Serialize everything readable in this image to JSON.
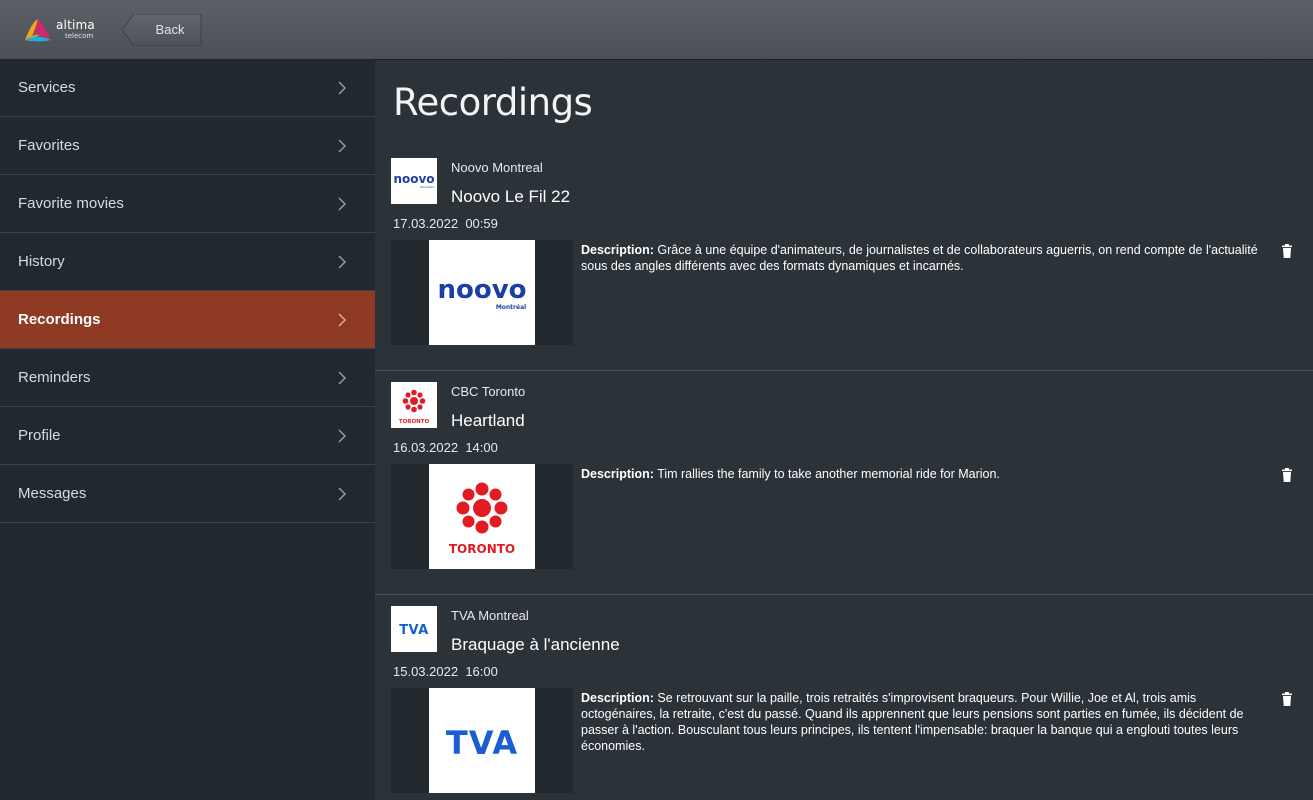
{
  "brand": {
    "name": "altima",
    "sub": "telecom",
    "colors": [
      "#f4a51c",
      "#e0246f",
      "#27a9e1",
      "#8bc540"
    ]
  },
  "header": {
    "back_label": "Back"
  },
  "sidebar": {
    "items": [
      {
        "label": "Services"
      },
      {
        "label": "Favorites"
      },
      {
        "label": "Favorite movies"
      },
      {
        "label": "History"
      },
      {
        "label": "Recordings",
        "active": true
      },
      {
        "label": "Reminders"
      },
      {
        "label": "Profile"
      },
      {
        "label": "Messages"
      }
    ],
    "active_color": "#8f3a24"
  },
  "main": {
    "title": "Recordings",
    "description_label": "Description:",
    "recordings": [
      {
        "channel": "Noovo Montreal",
        "title": "Noovo Le Fil 22",
        "date": "17.03.2022",
        "time": "00:59",
        "logo_text": "noovo",
        "logo_sub": "Montréal",
        "description": "Grâce à une équipe d'animateurs, de journalistes et de collaborateurs aguerris, on rend compte de l'actualité sous des angles différents avec des formats dynamiques et incarnés.",
        "icon": "noovo-logo"
      },
      {
        "channel": "CBC Toronto",
        "title": "Heartland",
        "date": "16.03.2022",
        "time": "14:00",
        "logo_text": "TORONTO",
        "description": "Tim rallies the family to take another memorial ride for Marion.",
        "icon": "cbc-gem-logo"
      },
      {
        "channel": "TVA Montreal",
        "title": "Braquage à l'ancienne",
        "date": "15.03.2022",
        "time": "16:00",
        "logo_text": "TVA",
        "description": "Se retrouvant sur la paille, trois retraités s'improvisent braqueurs. Pour Willie, Joe et Al, trois amis octogénaires, la retraite, c'est du passé. Quand ils apprennent que leurs pensions sont parties en fumée, ils décident de passer à l'action. Bousculant tous leurs principes, ils tentent l'impensable: braquer la banque qui a englouti toutes leurs économies.",
        "icon": "tva-logo"
      }
    ]
  }
}
